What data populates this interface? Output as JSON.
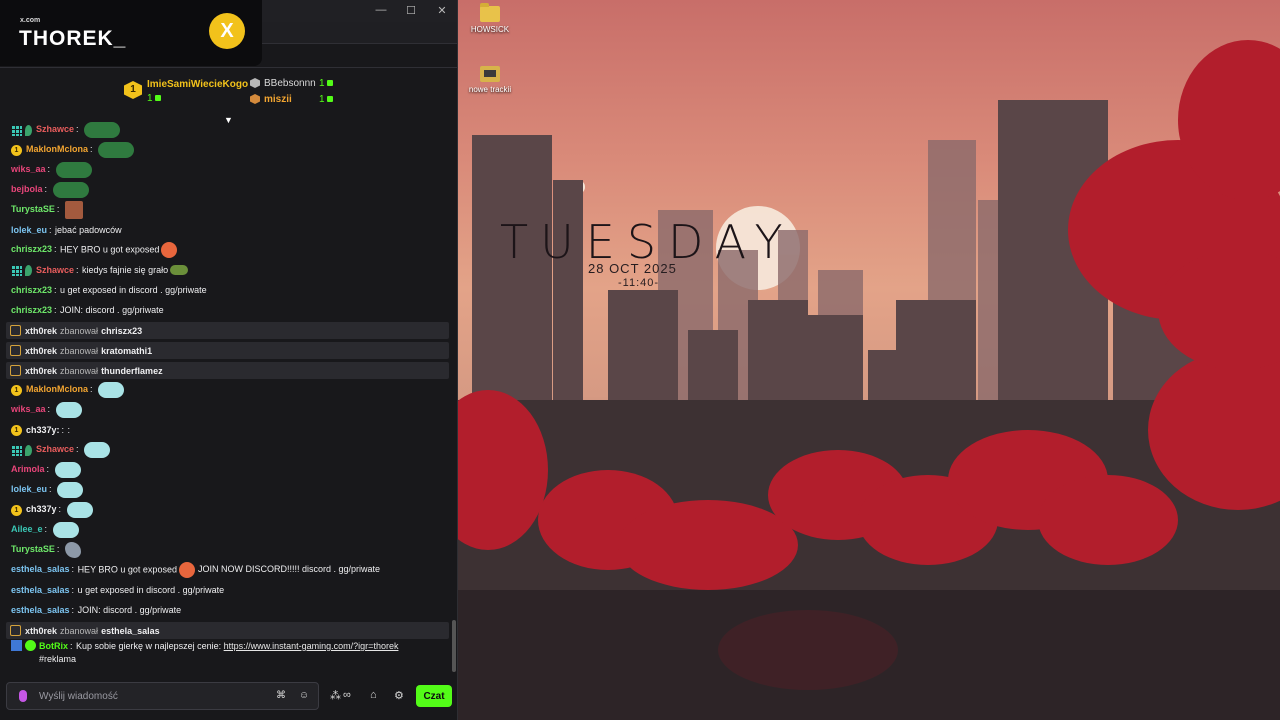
{
  "brand": {
    "small": "x.com",
    "name": "THOREK_",
    "coin": "X"
  },
  "window": {
    "min": "—",
    "max": "☐",
    "close": "✕"
  },
  "leaderboard": {
    "first": {
      "rank": "1",
      "name": "ImieSamiWiecieKogo",
      "count": "1",
      "name_color": "#f2c21b"
    },
    "second": {
      "name": "BBebsonnn",
      "count": "1",
      "name_color": "#d9d9d9"
    },
    "third": {
      "name": "miszii",
      "count": "1",
      "name_color": "#f2a531"
    },
    "expand": "▼"
  },
  "messages": [
    {
      "user": "Szhawce",
      "color": "#e85d5d",
      "badges": [
        "grid",
        "leaf"
      ],
      "text": "",
      "emote": "frog"
    },
    {
      "user": "MaklonMclona",
      "color": "#f2a531",
      "badges": [
        "one"
      ],
      "text": "",
      "emote": "frog"
    },
    {
      "user": "wiks_aa",
      "color": "#e8457a",
      "badges": [],
      "text": "",
      "emote": "frog"
    },
    {
      "user": "bejbola",
      "color": "#e8457a",
      "badges": [],
      "text": "",
      "emote": "frog"
    },
    {
      "user": "TurystaSE",
      "color": "#6ee96a",
      "badges": [],
      "text": "",
      "emote": "face"
    },
    {
      "user": "lolek_eu",
      "color": "#7cc4f0",
      "badges": [],
      "text": "jebać padowców",
      "emote": ""
    },
    {
      "user": "chriszx23",
      "color": "#6ee96a",
      "badges": [],
      "text": "HEY BRO u got exposed",
      "emote": "angry"
    },
    {
      "user": "Szhawce",
      "color": "#e85d5d",
      "badges": [
        "grid",
        "leaf"
      ],
      "text": "kiedys fajnie się grało",
      "emote": "cap"
    },
    {
      "user": "chriszx23",
      "color": "#6ee96a",
      "badges": [],
      "text": "u get exposed in discord . gg/priwate",
      "emote": ""
    },
    {
      "user": "chriszx23",
      "color": "#6ee96a",
      "badges": [],
      "text": "JOIN: discord . gg/priwate",
      "emote": ""
    },
    {
      "system": true,
      "mod": "xth0rek",
      "action": "zbanował",
      "target": "chriszx23"
    },
    {
      "system": true,
      "mod": "xth0rek",
      "action": "zbanował",
      "target": "kratomathi1"
    },
    {
      "system": true,
      "mod": "xth0rek",
      "action": "zbanował",
      "target": "thunderflamez"
    },
    {
      "user": "MaklonMclona",
      "color": "#f2a531",
      "badges": [
        "one"
      ],
      "text": "",
      "emote": "ghost"
    },
    {
      "user": "wiks_aa",
      "color": "#e8457a",
      "badges": [],
      "text": "",
      "emote": "ghost"
    },
    {
      "user": "ch337y:",
      "color": "#efeff1",
      "badges": [
        "one"
      ],
      "text": ":",
      "emote": ""
    },
    {
      "user": "Szhawce",
      "color": "#e85d5d",
      "badges": [
        "grid",
        "leaf"
      ],
      "text": "",
      "emote": "ghost"
    },
    {
      "user": "Arimola",
      "color": "#e8457a",
      "badges": [],
      "text": "",
      "emote": "ghost"
    },
    {
      "user": "lolek_eu",
      "color": "#7cc4f0",
      "badges": [],
      "text": "",
      "emote": "ghost"
    },
    {
      "user": "ch337y",
      "color": "#efeff1",
      "badges": [
        "one"
      ],
      "text": "",
      "emote": "ghost"
    },
    {
      "user": "Ailee_e",
      "color": "#3ac7b5",
      "badges": [],
      "text": "",
      "emote": "ghost"
    },
    {
      "user": "TurystaSE",
      "color": "#6ee96a",
      "badges": [],
      "text": "",
      "emote": "bird"
    },
    {
      "user": "esthela_salas",
      "color": "#7cc4f0",
      "badges": [],
      "text": "HEY BRO u got exposed",
      "emote": "angry",
      "after": "JOIN NOW DISCORD!!!!! discord . gg/priwate"
    },
    {
      "user": "esthela_salas",
      "color": "#7cc4f0",
      "badges": [],
      "text": "u get exposed in discord . gg/priwate",
      "emote": ""
    },
    {
      "user": "esthela_salas",
      "color": "#7cc4f0",
      "badges": [],
      "text": "JOIN: discord . gg/priwate",
      "emote": ""
    },
    {
      "system": true,
      "mod": "xth0rek",
      "action": "zbanował",
      "target": "esthela_salas"
    },
    {
      "user": "BotRix",
      "color": "#53fc18",
      "badges": [
        "bolt",
        "check"
      ],
      "text": "Kup sobie gierkę w najlepszej cenie:",
      "link": "https://www.instant-gaming.com/?igr=thorek",
      "line2": "#reklama",
      "tall": true
    }
  ],
  "input": {
    "placeholder": "Wyślij wiadomość",
    "send_label": "Czat"
  },
  "desktop": {
    "icons": [
      {
        "label": "HOWSICK"
      },
      {
        "label": "nowe trackii"
      }
    ],
    "clock": {
      "day": "TUESDAY",
      "date": "28 OCT 2025",
      "time": "-11:40-"
    }
  }
}
